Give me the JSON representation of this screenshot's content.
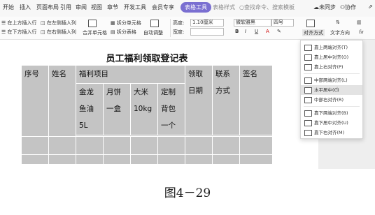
{
  "menu": {
    "tabs": [
      "开始",
      "插入",
      "页面布局",
      "引用",
      "审阅",
      "视图",
      "章节",
      "开发工具",
      "会员专享"
    ],
    "active_tab": "表格工具",
    "faded_tab": "表格样式",
    "search_placeholder": "查找命令、搜索模板",
    "sync_label": "未同步",
    "collab_label": "协作"
  },
  "toolbar": {
    "insert_above": "在上方插入行",
    "insert_left": "在左侧插入列",
    "insert_below": "在下方插入行",
    "insert_right": "在右侧插入列",
    "merge_cells": "合并单元格",
    "split_cells": "拆分单元格",
    "split_table": "拆分表格",
    "autofit": "自动调整",
    "height_label": "高度:",
    "height_value": "1.10厘米",
    "width_label": "宽度:",
    "font_name": "微软雅黑",
    "font_size": "四号",
    "align_label": "对齐方式",
    "text_direction": "文字方向",
    "bold": "B",
    "italic": "I",
    "underline": "U"
  },
  "document": {
    "title": "员工福利领取登记表",
    "headers": {
      "seq": "序号",
      "name": "姓名",
      "benefits": "福利项目",
      "date": "领取日期",
      "contact": "联系方式",
      "sign": "签名"
    },
    "items": [
      {
        "lines": [
          "金龙",
          "鱼油",
          "5L"
        ]
      },
      {
        "lines": [
          "月饼",
          "一盒"
        ]
      },
      {
        "lines": [
          "大米",
          "10kg"
        ]
      },
      {
        "lines": [
          "定制",
          "背包",
          "一个"
        ]
      }
    ]
  },
  "dropdown": {
    "items": [
      {
        "label": "靠上两端对齐(T)",
        "highlighted": false
      },
      {
        "label": "靠上居中对齐(O)",
        "highlighted": false
      },
      {
        "label": "靠上右对齐(P)",
        "highlighted": false
      },
      {
        "label": "中部两端对齐(L)",
        "highlighted": false
      },
      {
        "label": "水平居中(C)",
        "highlighted": true
      },
      {
        "label": "中部右对齐(R)",
        "highlighted": false
      },
      {
        "label": "靠下两端对齐(B)",
        "highlighted": false
      },
      {
        "label": "靠下居中对齐(U)",
        "highlighted": false
      },
      {
        "label": "靠下右对齐(M)",
        "highlighted": false
      }
    ]
  },
  "caption": "图4－29"
}
